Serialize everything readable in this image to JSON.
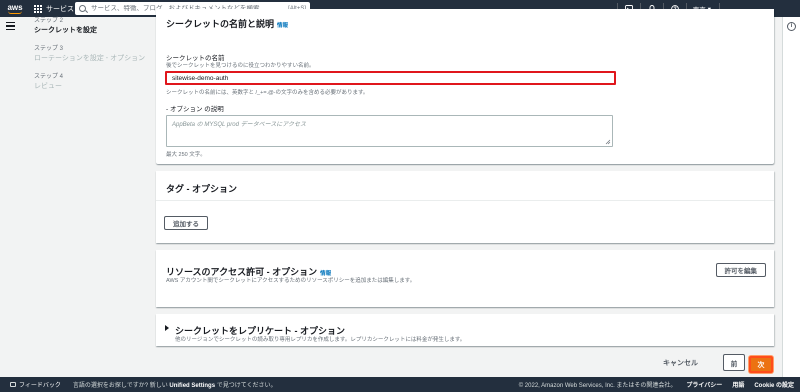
{
  "topbar": {
    "logo": "aws",
    "services_label": "サービス",
    "search_placeholder": "サービス、特徴、ブログ、およびドキュメントなどを検索",
    "search_shortcut": "[Alt+S]",
    "region": "東京",
    "icons": [
      "cloudshell-icon",
      "bell-icon",
      "help-icon"
    ]
  },
  "steps": [
    {
      "label": "ステップ 2",
      "name": "シークレットを設定",
      "active": true
    },
    {
      "label": "ステップ 3",
      "name": "ローテーションを設定 - オプション",
      "active": false
    },
    {
      "label": "ステップ 4",
      "name": "レビュー",
      "active": false
    }
  ],
  "name_panel": {
    "title": "シークレットの名前と説明",
    "info": "情報",
    "name_label": "シークレットの名前",
    "name_desc": "後でシークレットを見つけるのに役立つわかりやすい名前。",
    "name_value": "sitewise-demo-auth",
    "name_hint": "シークレットの名前には、英数字と /_+=.@-の文字のみを含める必要があります。",
    "desc_label": "- オプション の説明",
    "desc_placeholder": "AppBeta の MYSQL prod データベースにアクセス",
    "max_len": "最大 250 文字。"
  },
  "tags_panel": {
    "title": "タグ - オプション",
    "add_button": "追加する"
  },
  "access_panel": {
    "title": "リソースのアクセス許可 - オプション",
    "info": "情報",
    "desc": "AWS アカウント間でシークレットにアクセスするためのリソースポリシーを追加または編集します。",
    "edit_button": "許可を編集"
  },
  "replicate_panel": {
    "title": "シークレットをレプリケート - オプション",
    "desc": "他のリージョンでシークレットの読み取り専用レプリカを作成します。レプリカシークレットには料金が発生します。"
  },
  "actions": {
    "cancel": "キャンセル",
    "prev": "前",
    "next": "次"
  },
  "footer": {
    "feedback": "フィードバック",
    "lang_prefix": "言語の選択をお探しですか? 新しい ",
    "lang_link": "Unified Settings",
    "lang_suffix": " で見つけてください。",
    "copyright": "© 2022, Amazon Web Services, Inc. またはその関連会社。",
    "privacy": "プライバシー",
    "terms": "用語",
    "cookie": "Cookie の設定"
  },
  "colors": {
    "header_bg": "#232f3e",
    "primary": "#ec7211",
    "highlight": "#e0161c",
    "link": "#0073bb"
  }
}
